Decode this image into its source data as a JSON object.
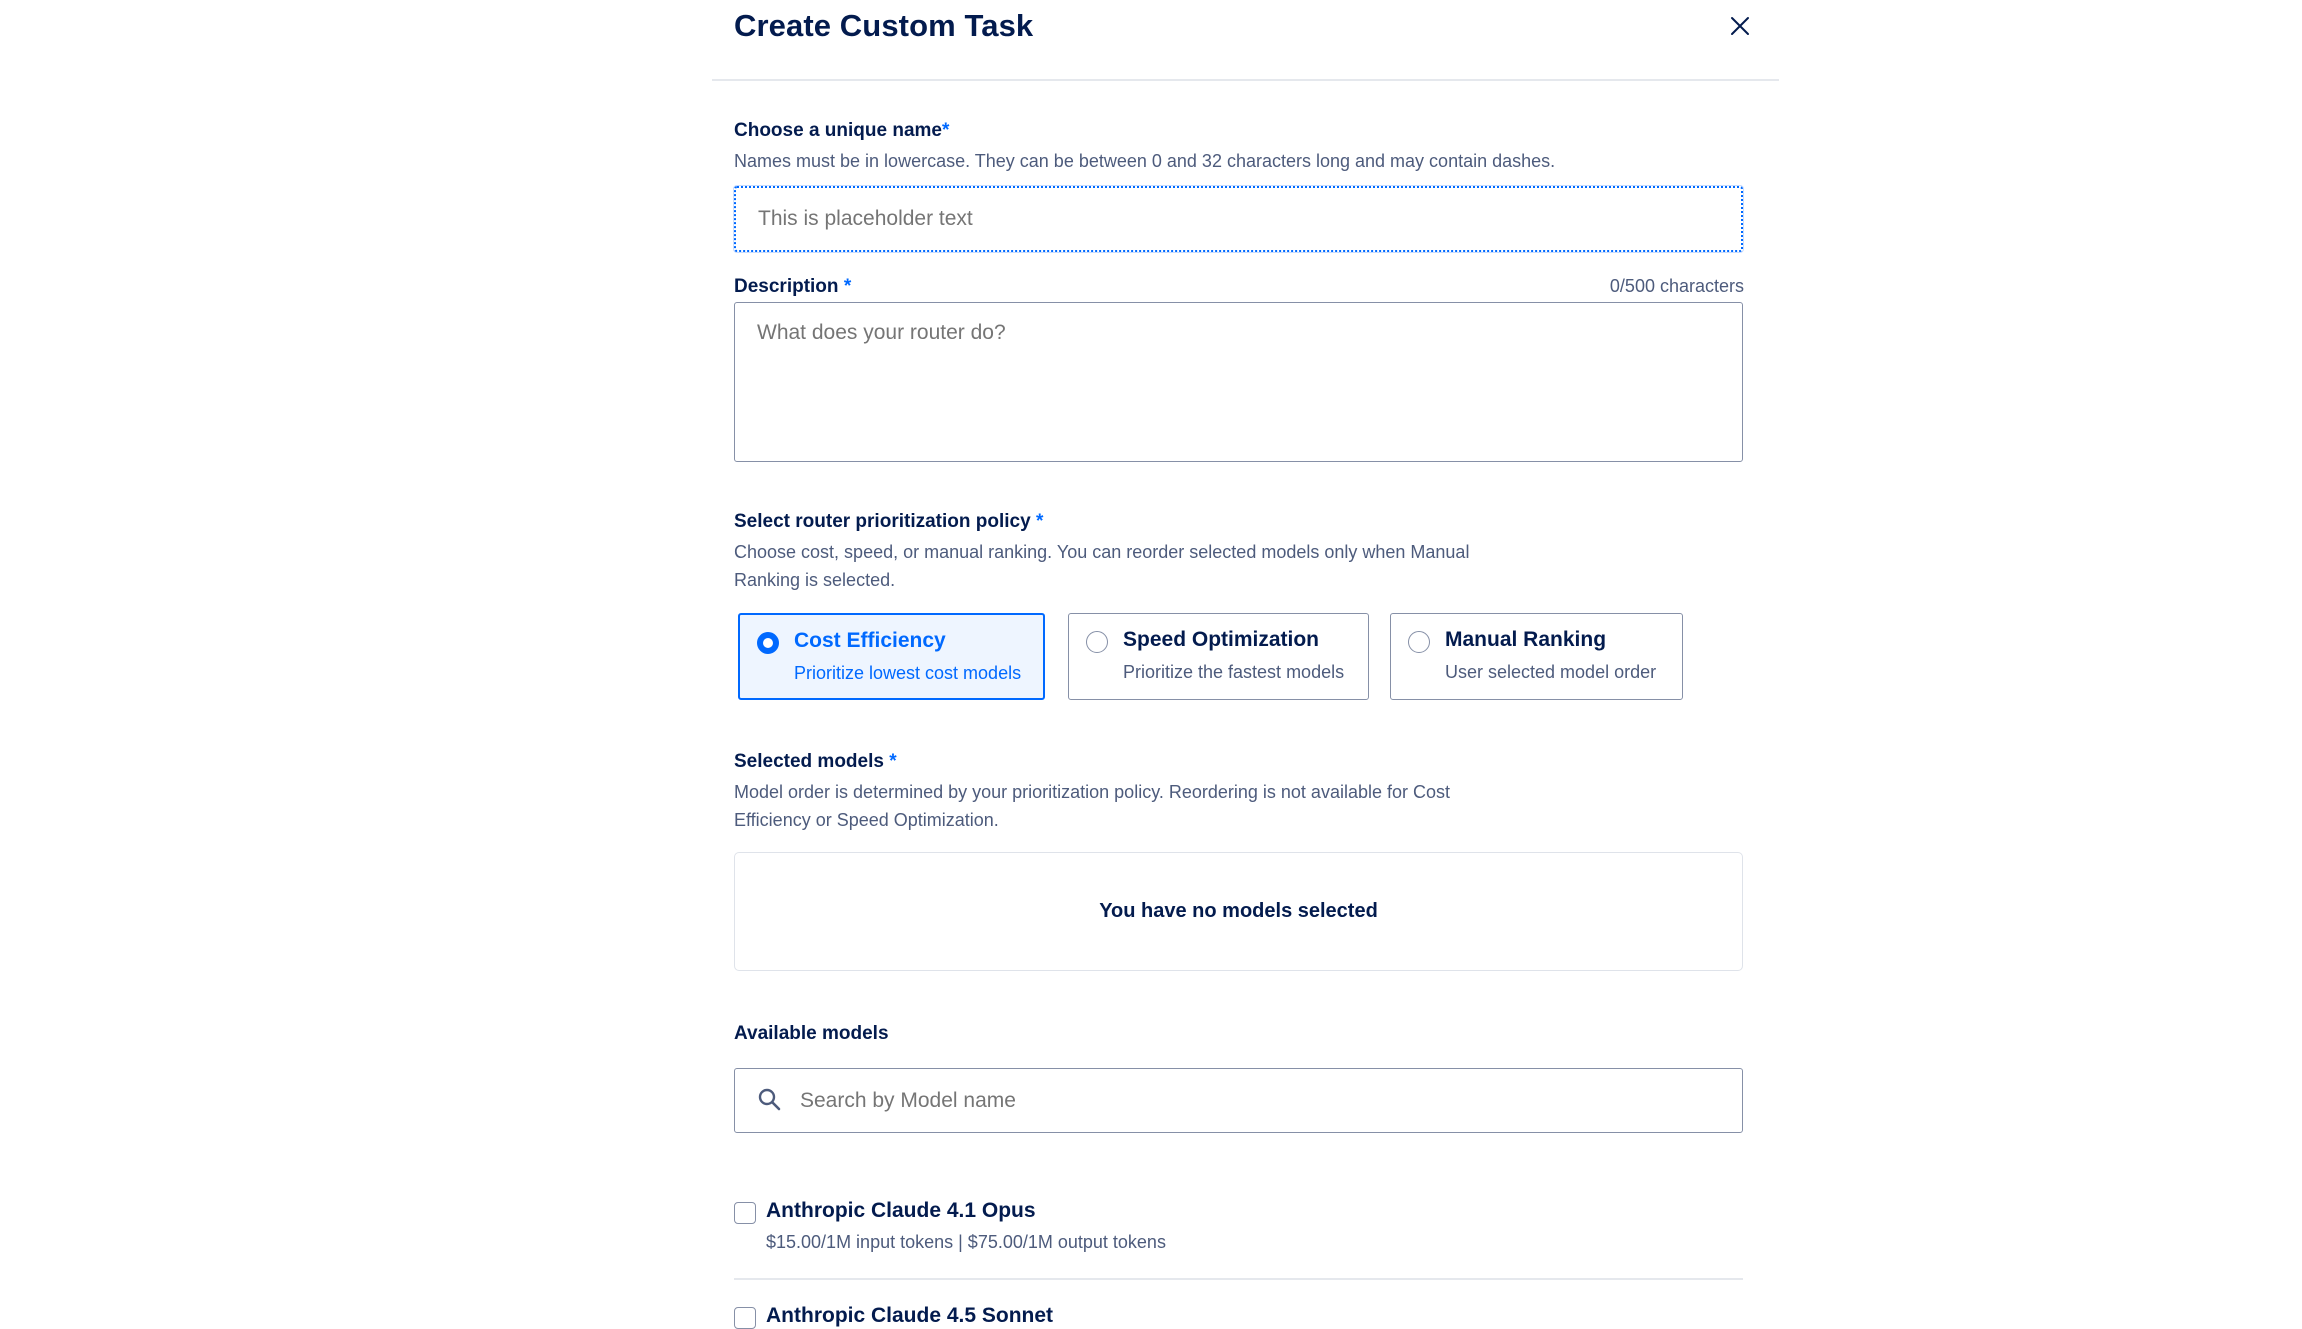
{
  "modal": {
    "title": "Create Custom Task",
    "close_icon": "close-icon"
  },
  "name_field": {
    "label": "Choose a unique name",
    "required_mark": "*",
    "help": "Names must be in lowercase. They can be between 0 and 32 characters long and may contain dashes.",
    "placeholder": "This is placeholder text",
    "value": ""
  },
  "description_field": {
    "label": "Description",
    "required_mark": "*",
    "char_count": "0/500 characters",
    "placeholder": "What does your router do?",
    "value": ""
  },
  "policy": {
    "label": "Select router prioritization policy",
    "required_mark": "*",
    "help_line1": "Choose cost, speed, or manual ranking. You can reorder selected models only when Manual",
    "help_line2": "Ranking is selected.",
    "options": [
      {
        "title": "Cost Efficiency",
        "subtitle": "Prioritize lowest cost models",
        "selected": true
      },
      {
        "title": "Speed Optimization",
        "subtitle": "Prioritize the fastest models",
        "selected": false
      },
      {
        "title": "Manual Ranking",
        "subtitle": "User selected model order",
        "selected": false
      }
    ]
  },
  "selected_models": {
    "label": "Selected models",
    "required_mark": "*",
    "help_line1": "Model order is determined by your prioritization policy. Reordering is not available for Cost",
    "help_line2": "Efficiency or Speed Optimization.",
    "empty_text": "You have no models selected"
  },
  "available_models": {
    "label": "Available models",
    "search_placeholder": "Search by Model name",
    "search_icon": "search-icon",
    "items": [
      {
        "name": "Anthropic Claude 4.1 Opus",
        "price": "$15.00/1M input tokens | $75.00/1M output tokens",
        "checked": false
      },
      {
        "name": "Anthropic Claude 4.5 Sonnet",
        "price": "",
        "checked": false
      }
    ]
  },
  "colors": {
    "accent": "#0069ff",
    "text_primary": "#031b4e",
    "text_secondary": "#4d5b7c",
    "border": "#8690a7",
    "selected_bg": "#eef5ff"
  }
}
